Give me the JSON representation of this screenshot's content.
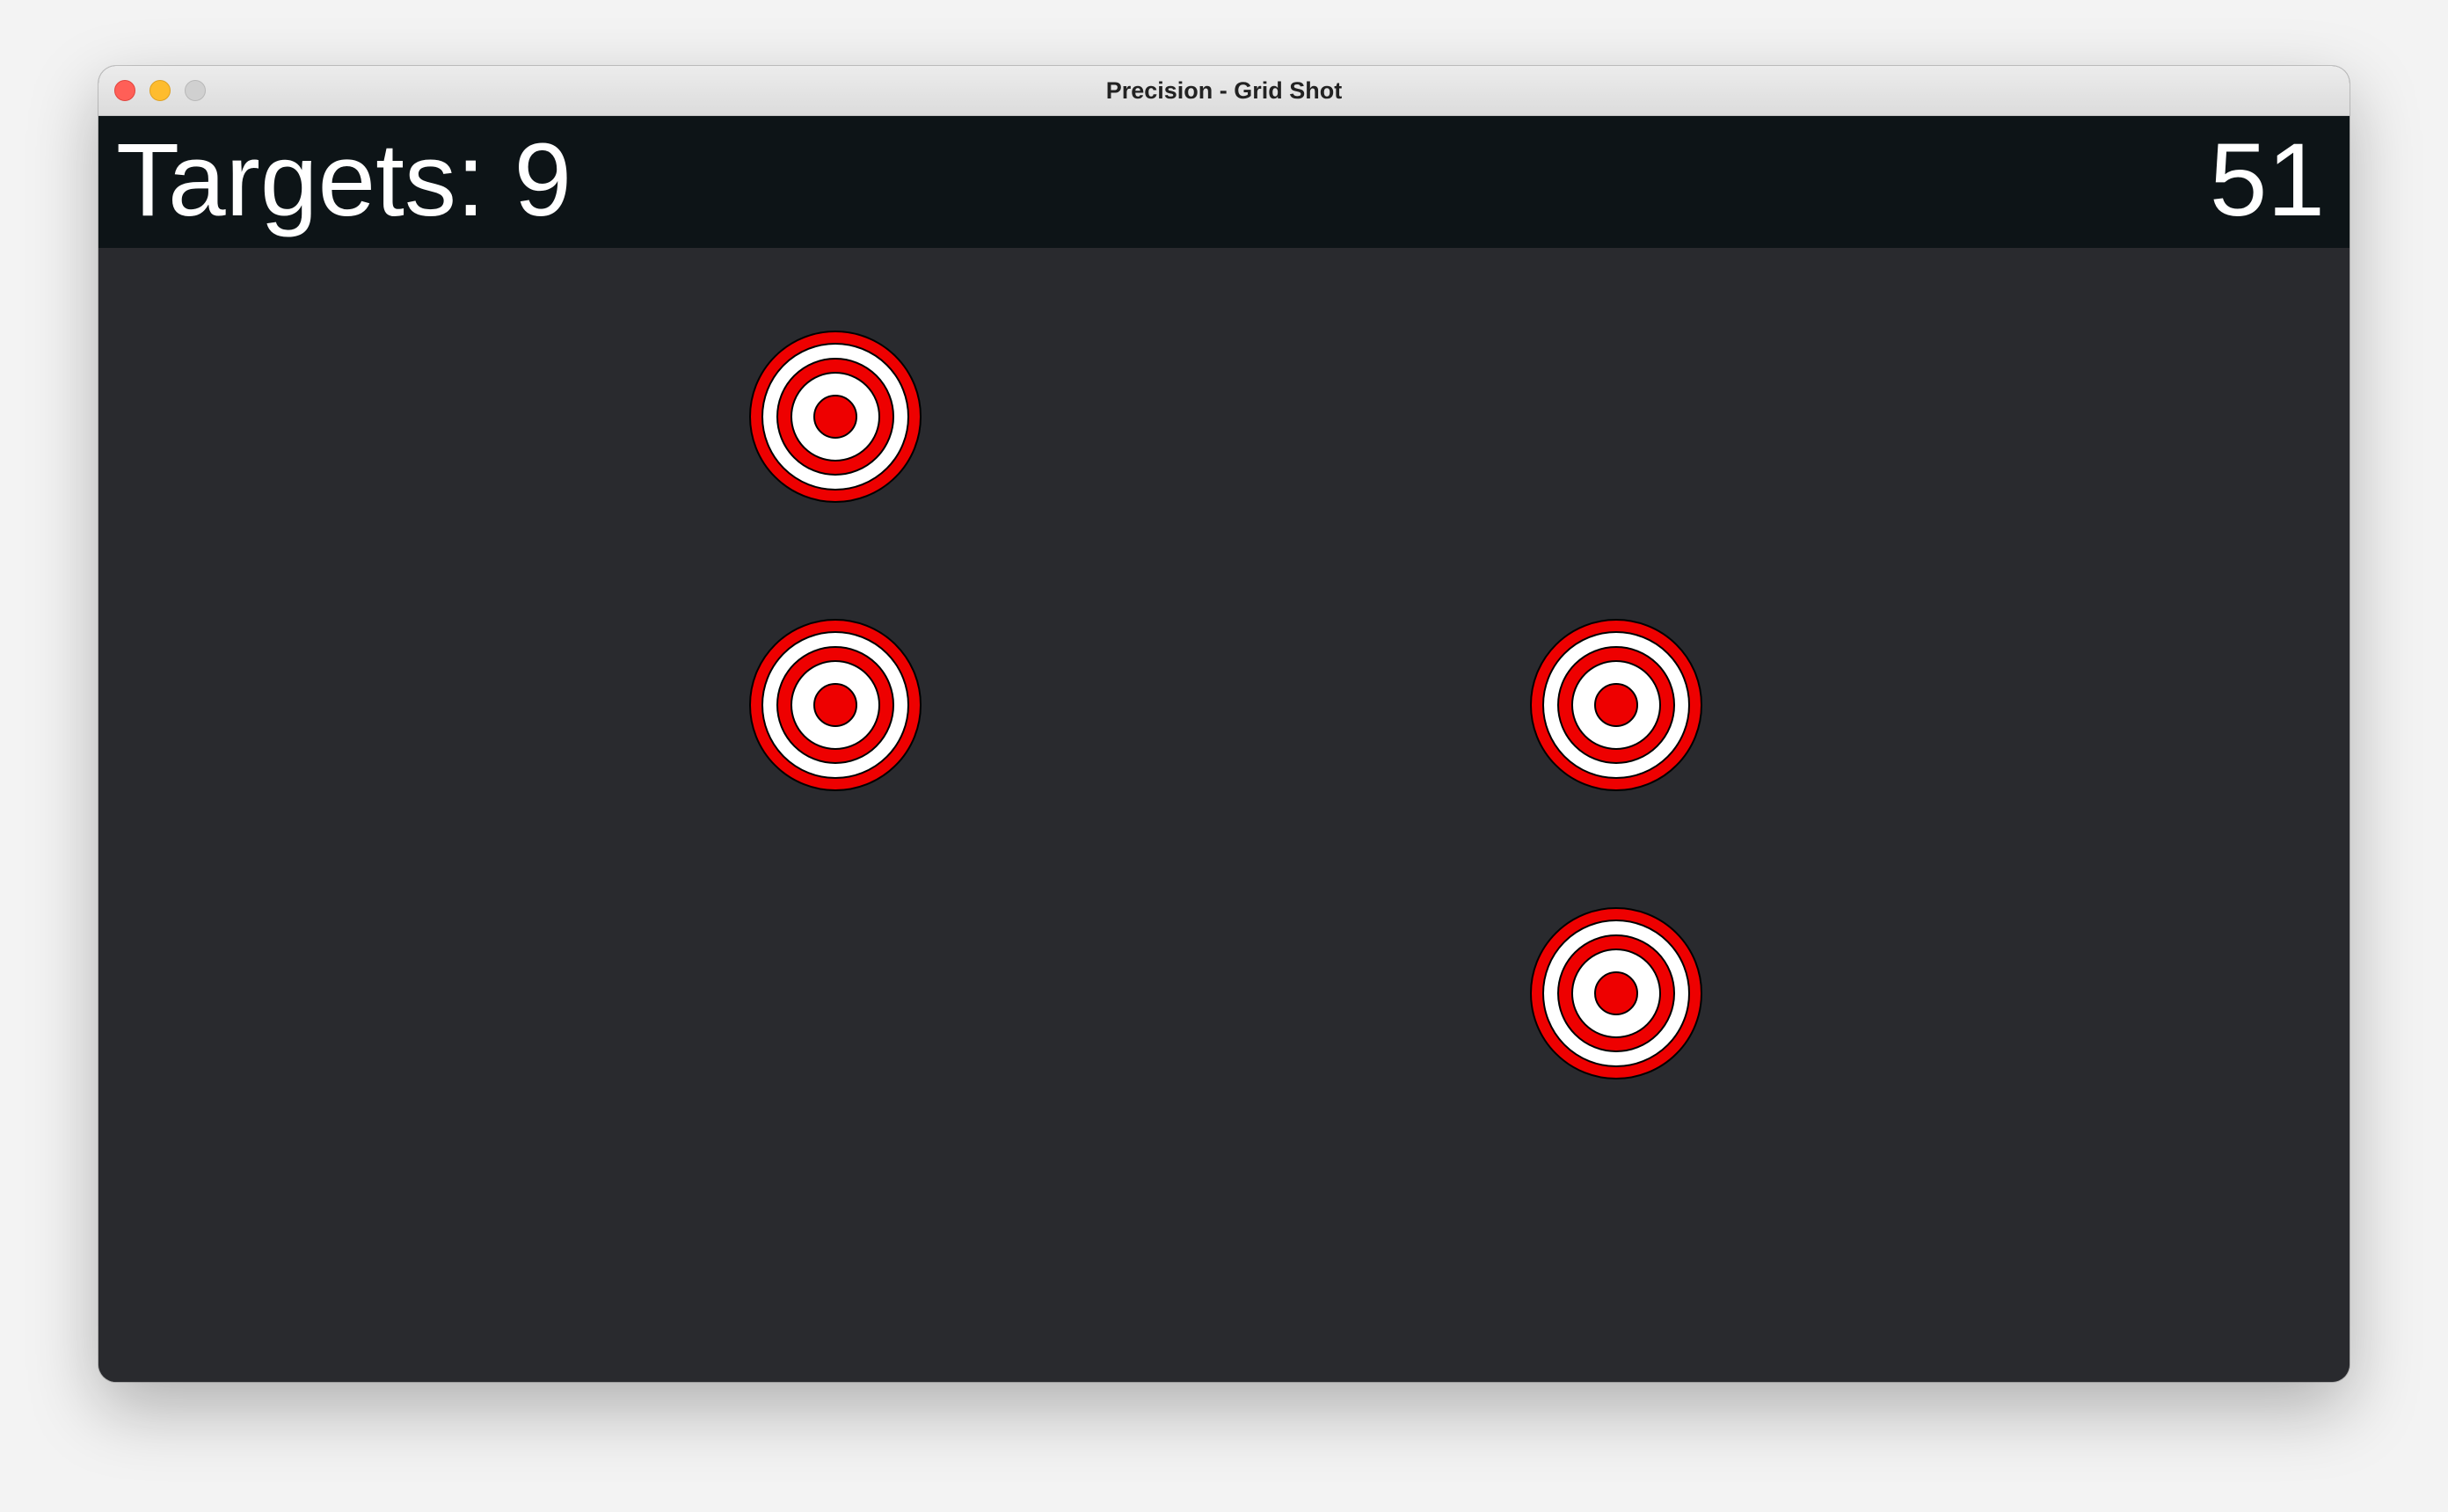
{
  "window": {
    "title": "Precision - Grid Shot"
  },
  "hud": {
    "targets_label": "Targets: 9",
    "timer": "51"
  },
  "colors": {
    "hud_background": "#0d1417",
    "arena_background": "#292a2e",
    "target_red": "#ee0000",
    "target_white": "#ffffff"
  },
  "grid": {
    "columns": 3,
    "rows": 3,
    "active_cells": [
      {
        "row": 1,
        "col": 1
      },
      {
        "row": 2,
        "col": 1
      },
      {
        "row": 2,
        "col": 2
      },
      {
        "row": 3,
        "col": 2
      }
    ]
  }
}
